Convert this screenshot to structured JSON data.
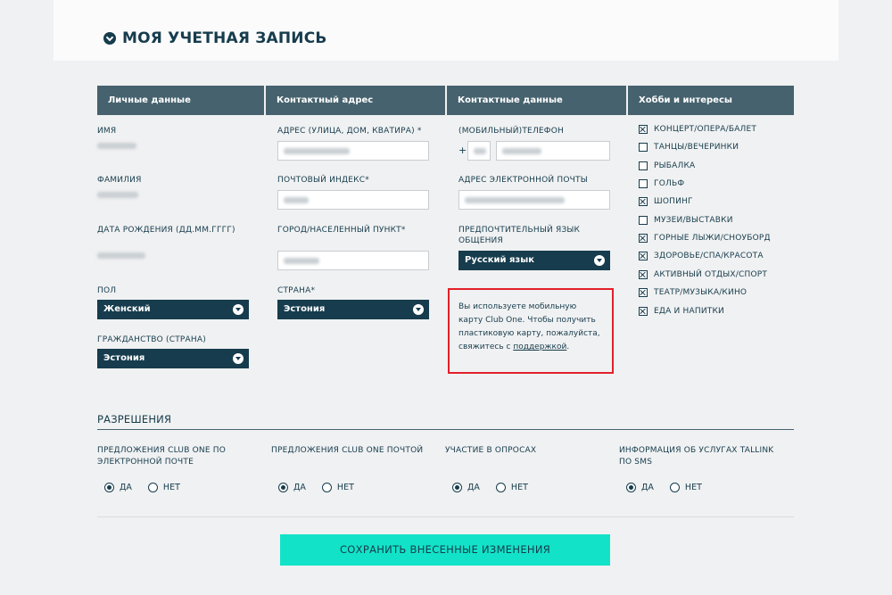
{
  "page": {
    "title": "МОЯ УЧЕТНАЯ ЗАПИСЬ"
  },
  "columns": [
    "Личные данные",
    "Контактный адрес",
    "Контактные данные",
    "Хобби и интересы"
  ],
  "personal": {
    "first_name_label": "ИМЯ",
    "last_name_label": "ФАМИЛИЯ",
    "birth_label": "ДАТА РОЖДЕНИЯ (ДД.ММ.ГГГГ)",
    "gender_label": "ПОЛ",
    "gender_value": "Женский",
    "citizenship_label": "ГРАЖДАНСТВО (СТРАНА)",
    "citizenship_value": "Эстония"
  },
  "address": {
    "street_label": "АДРЕС (УЛИЦА, ДОМ, КВАТИРА) *",
    "postal_label": "ПОЧТОВЫЙ ИНДЕКС*",
    "city_label": "ГОРОД/НАСЕЛЕННЫЙ ПУНКТ*",
    "country_label": "СТРАНА*",
    "country_value": "Эстония"
  },
  "contact": {
    "phone_label": "(МОБИЛЬНЫЙ)ТЕЛЕФОН",
    "phone_plus": "+",
    "email_label": "АДРЕС ЭЛЕКТРОННОЙ ПОЧТЫ",
    "language_label": "ПРЕДПОЧТИТЕЛЬНЫЙ ЯЗЫК ОБЩЕНИЯ",
    "language_value": "Русский язык",
    "notice_text": "Вы используете мобильную карту Club One. Чтобы получить пластиковую карту, пожалуйста, свяжитесь с",
    "notice_link": "поддержкой",
    "notice_end": "."
  },
  "hobbies": [
    {
      "label": "КОНЦЕРТ/ОПЕРА/БАЛЕТ",
      "checked": true
    },
    {
      "label": "ТАНЦЫ/ВЕЧЕРИНКИ",
      "checked": false
    },
    {
      "label": "РЫБАЛКА",
      "checked": false
    },
    {
      "label": "ГОЛЬФ",
      "checked": false
    },
    {
      "label": "ШОПИНГ",
      "checked": true
    },
    {
      "label": "МУЗЕИ/ВЫСТАВКИ",
      "checked": false
    },
    {
      "label": "ГОРНЫЕ ЛЫЖИ/СНОУБОРД",
      "checked": true
    },
    {
      "label": "ЗДОРОВЬЕ/СПА/КРАСОТА",
      "checked": true
    },
    {
      "label": "АКТИВНЫЙ ОТДЫХ/СПОРТ",
      "checked": true
    },
    {
      "label": "ТЕАТР/МУЗЫКА/КИНО",
      "checked": true
    },
    {
      "label": "ЕДА И НАПИТКИ",
      "checked": true
    }
  ],
  "permissions": {
    "title": "РАЗРЕШЕНИЯ",
    "yes_label": "ДА",
    "no_label": "НЕТ",
    "items": [
      {
        "label": "ПРЕДЛОЖЕНИЯ CLUB ONE ПО ЭЛЕКТРОННОЙ ПОЧТЕ",
        "selected": "yes"
      },
      {
        "label": "ПРЕДЛОЖЕНИЯ CLUB ONE ПОЧТОЙ",
        "selected": "yes"
      },
      {
        "label": "УЧАСТИЕ В ОПРОСАХ",
        "selected": "yes"
      },
      {
        "label": "ИНФОРМАЦИЯ ОБ УСЛУГАХ TALLINK ПО SMS",
        "selected": "yes"
      }
    ]
  },
  "save_button": "СОХРАНИТЬ ВНЕСЕННЫЕ ИЗМЕНЕНИЯ"
}
